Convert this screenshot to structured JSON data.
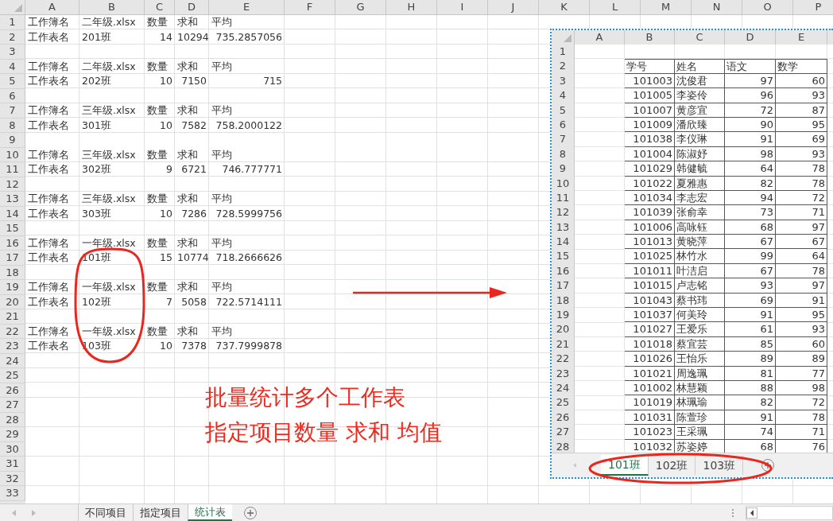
{
  "sheet": {
    "columns": [
      "A",
      "B",
      "C",
      "D",
      "E",
      "F",
      "G",
      "H",
      "I",
      "J",
      "K",
      "L",
      "M",
      "N",
      "O",
      "P"
    ],
    "rows": [
      {
        "number": "1",
        "kind": "header",
        "cells": [
          "工作簿名",
          "二年级.xlsx",
          "数量",
          "求和",
          "平均"
        ]
      },
      {
        "number": "2",
        "kind": "values",
        "cells": [
          "工作表名",
          "201班",
          "14",
          "10294",
          "735.2857056"
        ]
      },
      {
        "number": "3"
      },
      {
        "number": "4",
        "kind": "header",
        "cells": [
          "工作簿名",
          "二年级.xlsx",
          "数量",
          "求和",
          "平均"
        ]
      },
      {
        "number": "5",
        "kind": "values",
        "cells": [
          "工作表名",
          "202班",
          "10",
          "7150",
          "715"
        ]
      },
      {
        "number": "6"
      },
      {
        "number": "7",
        "kind": "header",
        "cells": [
          "工作簿名",
          "三年级.xlsx",
          "数量",
          "求和",
          "平均"
        ]
      },
      {
        "number": "8",
        "kind": "values",
        "cells": [
          "工作表名",
          "301班",
          "10",
          "7582",
          "758.2000122"
        ]
      },
      {
        "number": "9"
      },
      {
        "number": "10",
        "kind": "header",
        "cells": [
          "工作簿名",
          "三年级.xlsx",
          "数量",
          "求和",
          "平均"
        ]
      },
      {
        "number": "11",
        "kind": "values",
        "cells": [
          "工作表名",
          "302班",
          "9",
          "6721",
          "746.777771"
        ]
      },
      {
        "number": "12"
      },
      {
        "number": "13",
        "kind": "header",
        "cells": [
          "工作簿名",
          "三年级.xlsx",
          "数量",
          "求和",
          "平均"
        ]
      },
      {
        "number": "14",
        "kind": "values",
        "cells": [
          "工作表名",
          "303班",
          "10",
          "7286",
          "728.5999756"
        ]
      },
      {
        "number": "15"
      },
      {
        "number": "16",
        "kind": "header",
        "cells": [
          "工作簿名",
          "一年级.xlsx",
          "数量",
          "求和",
          "平均"
        ]
      },
      {
        "number": "17",
        "kind": "values",
        "cells": [
          "工作表名",
          "101班",
          "15",
          "10774",
          "718.2666626"
        ]
      },
      {
        "number": "18"
      },
      {
        "number": "19",
        "kind": "header",
        "cells": [
          "工作簿名",
          "一年级.xlsx",
          "数量",
          "求和",
          "平均"
        ]
      },
      {
        "number": "20",
        "kind": "values",
        "cells": [
          "工作表名",
          "102班",
          "7",
          "5058",
          "722.5714111"
        ]
      },
      {
        "number": "21"
      },
      {
        "number": "22",
        "kind": "header",
        "cells": [
          "工作簿名",
          "一年级.xlsx",
          "数量",
          "求和",
          "平均"
        ]
      },
      {
        "number": "23",
        "kind": "values",
        "cells": [
          "工作表名",
          "103班",
          "10",
          "7378",
          "737.7999878"
        ]
      },
      {
        "number": "24"
      },
      {
        "number": "25"
      },
      {
        "number": "26"
      },
      {
        "number": "27"
      },
      {
        "number": "28"
      },
      {
        "number": "29"
      },
      {
        "number": "30"
      },
      {
        "number": "31"
      },
      {
        "number": "32"
      },
      {
        "number": "33"
      }
    ]
  },
  "sheet_tabs": [
    {
      "label": "不同项目",
      "selected": false
    },
    {
      "label": "指定项目",
      "selected": false
    },
    {
      "label": "统计表",
      "selected": true
    }
  ],
  "embedded_sheet": {
    "columns": [
      "A",
      "B",
      "C",
      "D",
      "E"
    ],
    "rows": [
      {
        "number": "1"
      },
      {
        "number": "2",
        "kind": "header",
        "cells": [
          "",
          "学号",
          "姓名",
          "语文",
          "数学"
        ]
      },
      {
        "number": "3",
        "kind": "data",
        "cells": [
          "",
          "101003",
          "沈俊君",
          "97",
          "60"
        ]
      },
      {
        "number": "4",
        "kind": "data",
        "cells": [
          "",
          "101005",
          "李姿伶",
          "96",
          "93"
        ]
      },
      {
        "number": "5",
        "kind": "data",
        "cells": [
          "",
          "101007",
          "黄彦宜",
          "72",
          "87"
        ]
      },
      {
        "number": "6",
        "kind": "data",
        "cells": [
          "",
          "101009",
          "潘欣臻",
          "90",
          "95"
        ]
      },
      {
        "number": "7",
        "kind": "data",
        "cells": [
          "",
          "101038",
          "李仪琳",
          "91",
          "69"
        ]
      },
      {
        "number": "8",
        "kind": "data",
        "cells": [
          "",
          "101004",
          "陈淑妤",
          "98",
          "93"
        ]
      },
      {
        "number": "9",
        "kind": "data",
        "cells": [
          "",
          "101029",
          "韩健毓",
          "64",
          "78"
        ]
      },
      {
        "number": "10",
        "kind": "data",
        "cells": [
          "",
          "101022",
          "夏雅惠",
          "82",
          "78"
        ]
      },
      {
        "number": "11",
        "kind": "data",
        "cells": [
          "",
          "101034",
          "李志宏",
          "94",
          "72"
        ]
      },
      {
        "number": "12",
        "kind": "data",
        "cells": [
          "",
          "101039",
          "张俞幸",
          "73",
          "71"
        ]
      },
      {
        "number": "13",
        "kind": "data",
        "cells": [
          "",
          "101006",
          "高咏钰",
          "68",
          "97"
        ]
      },
      {
        "number": "14",
        "kind": "data",
        "cells": [
          "",
          "101013",
          "黄晓萍",
          "67",
          "67"
        ]
      },
      {
        "number": "15",
        "kind": "data",
        "cells": [
          "",
          "101025",
          "林竹水",
          "99",
          "64"
        ]
      },
      {
        "number": "16",
        "kind": "data",
        "cells": [
          "",
          "101011",
          "叶洁启",
          "67",
          "78"
        ]
      },
      {
        "number": "17",
        "kind": "data",
        "cells": [
          "",
          "101015",
          "卢志铭",
          "93",
          "97"
        ]
      },
      {
        "number": "18",
        "kind": "data",
        "cells": [
          "",
          "101043",
          "蔡书玮",
          "69",
          "91"
        ]
      },
      {
        "number": "19",
        "kind": "data",
        "cells": [
          "",
          "101037",
          "何美玲",
          "91",
          "95"
        ]
      },
      {
        "number": "20",
        "kind": "data",
        "cells": [
          "",
          "101027",
          "王爱乐",
          "61",
          "93"
        ]
      },
      {
        "number": "21",
        "kind": "data",
        "cells": [
          "",
          "101018",
          "蔡宜芸",
          "85",
          "60"
        ]
      },
      {
        "number": "22",
        "kind": "data",
        "cells": [
          "",
          "101026",
          "王怡乐",
          "89",
          "89"
        ]
      },
      {
        "number": "23",
        "kind": "data",
        "cells": [
          "",
          "101021",
          "周逸珮",
          "81",
          "77"
        ]
      },
      {
        "number": "24",
        "kind": "data",
        "cells": [
          "",
          "101002",
          "林慧颖",
          "88",
          "98"
        ]
      },
      {
        "number": "25",
        "kind": "data",
        "cells": [
          "",
          "101019",
          "林珮瑜",
          "82",
          "72"
        ]
      },
      {
        "number": "26",
        "kind": "data",
        "cells": [
          "",
          "101031",
          "陈萱珍",
          "91",
          "78"
        ]
      },
      {
        "number": "27",
        "kind": "data",
        "cells": [
          "",
          "101023",
          "王采珮",
          "74",
          "71"
        ]
      },
      {
        "number": "28",
        "kind": "data",
        "cells": [
          "",
          "101032",
          "苏姿婷",
          "68",
          "76"
        ]
      }
    ],
    "tabs": [
      {
        "label": "101班",
        "selected": true
      },
      {
        "label": "102班",
        "selected": false
      },
      {
        "label": "103班",
        "selected": false
      }
    ]
  },
  "annotation": {
    "lines": [
      "批量统计多个工作表",
      "指定项目数量 求和 均值"
    ]
  }
}
